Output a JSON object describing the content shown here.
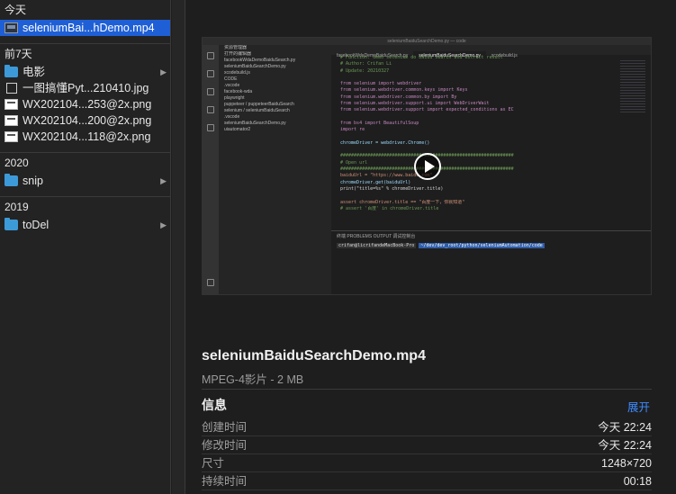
{
  "sidebar": {
    "sections": [
      {
        "title": "今天",
        "items": [
          {
            "label": "seleniumBai...hDemo.mp4",
            "icon": "video-file-icon",
            "selected": true
          }
        ]
      },
      {
        "title": "前7天",
        "items": [
          {
            "label": "电影",
            "icon": "folder-icon",
            "has_children": true
          },
          {
            "label": "一图搞懂Pyt...210410.jpg",
            "icon": "image-file-icon"
          },
          {
            "label": "WX202104...253@2x.png",
            "icon": "screenshot-file-icon"
          },
          {
            "label": "WX202104...200@2x.png",
            "icon": "screenshot-file-icon"
          },
          {
            "label": "WX202104...118@2x.png",
            "icon": "screenshot-file-icon"
          }
        ]
      },
      {
        "title": "2020",
        "items": [
          {
            "label": "snip",
            "icon": "folder-icon",
            "has_children": true
          }
        ]
      },
      {
        "title": "2019",
        "items": [
          {
            "label": "toDel",
            "icon": "folder-icon",
            "has_children": true
          }
        ]
      }
    ]
  },
  "preview": {
    "thumbnail": {
      "window_title": "seleniumBaiduSearchDemo.py — code",
      "explorer": [
        "资源管理器",
        "打开的编辑器",
        "facebookWdaDemoBaiduSearch.py",
        "seleniumBaiduSearchDemo.py",
        "xcodebuild.js",
        "CODE",
        ".vscode",
        "facebook-wda",
        "playwright",
        "puppeteer / puppeteerBaiduSearch",
        "selenium / seleniumBaiduSearch",
        ".vscode",
        "seleniumBaiduSearchDemo.py",
        "uiautomator2"
      ],
      "tabs": [
        "facebookWdaDemoBaiduSearch.py",
        "seleniumBaiduSearchDemo.py",
        "xcodebuild.js"
      ],
      "code_lines": [
        [
          "c-com",
          "# Function: demo selenium do baidu search and extract result"
        ],
        [
          "c-com",
          "# Author: Crifan Li"
        ],
        [
          "c-com",
          "# Update: 20210327"
        ],
        [
          "c-pl",
          ""
        ],
        [
          "c-kw",
          "from selenium import webdriver"
        ],
        [
          "c-kw",
          "from selenium.webdriver.common.keys import Keys"
        ],
        [
          "c-kw",
          "from selenium.webdriver.common.by import By"
        ],
        [
          "c-kw",
          "from selenium.webdriver.support.ui import WebDriverWait"
        ],
        [
          "c-kw",
          "from selenium.webdriver.support import expected_conditions as EC"
        ],
        [
          "c-pl",
          ""
        ],
        [
          "c-kw",
          "from bs4 import BeautifulSoup"
        ],
        [
          "c-kw",
          "import re"
        ],
        [
          "c-pl",
          ""
        ],
        [
          "c-var",
          "chromeDriver = webdriver.Chrome()"
        ],
        [
          "c-pl",
          ""
        ],
        [
          "c-com",
          "################################################################"
        ],
        [
          "c-com",
          "# Open url"
        ],
        [
          "c-com",
          "################################################################"
        ],
        [
          "c-str",
          "baiduUrl = \"https://www.baidu.com\""
        ],
        [
          "c-var",
          "chromeDriver.get(baiduUrl)"
        ],
        [
          "c-pl",
          "print(\"title=%s\" % chromeDriver.title)"
        ],
        [
          "c-pl",
          ""
        ],
        [
          "c-str",
          "assert chromeDriver.title == \"百度一下，你就知道\""
        ],
        [
          "c-com",
          "# assert '百度' in chromeDriver.title"
        ]
      ],
      "terminal_tabs": "终端   PROBLEMS   OUTPUT   调试控制台",
      "terminal_prompt": "crifan@licrifandeMacBook-Pro",
      "terminal_path": "~/dev/dev_root/python/seleniumAutomation/code"
    },
    "file_name": "seleniumBaiduSearchDemo.mp4",
    "file_meta": "MPEG-4影片 - 2 MB",
    "info_title": "信息",
    "show_more": "展开",
    "info_rows": [
      {
        "key": "创建时间",
        "value": "今天 22:24"
      },
      {
        "key": "修改时间",
        "value": "今天 22:24"
      },
      {
        "key": "尺寸",
        "value": "1248×720"
      },
      {
        "key": "持续时间",
        "value": "00:18"
      }
    ]
  }
}
